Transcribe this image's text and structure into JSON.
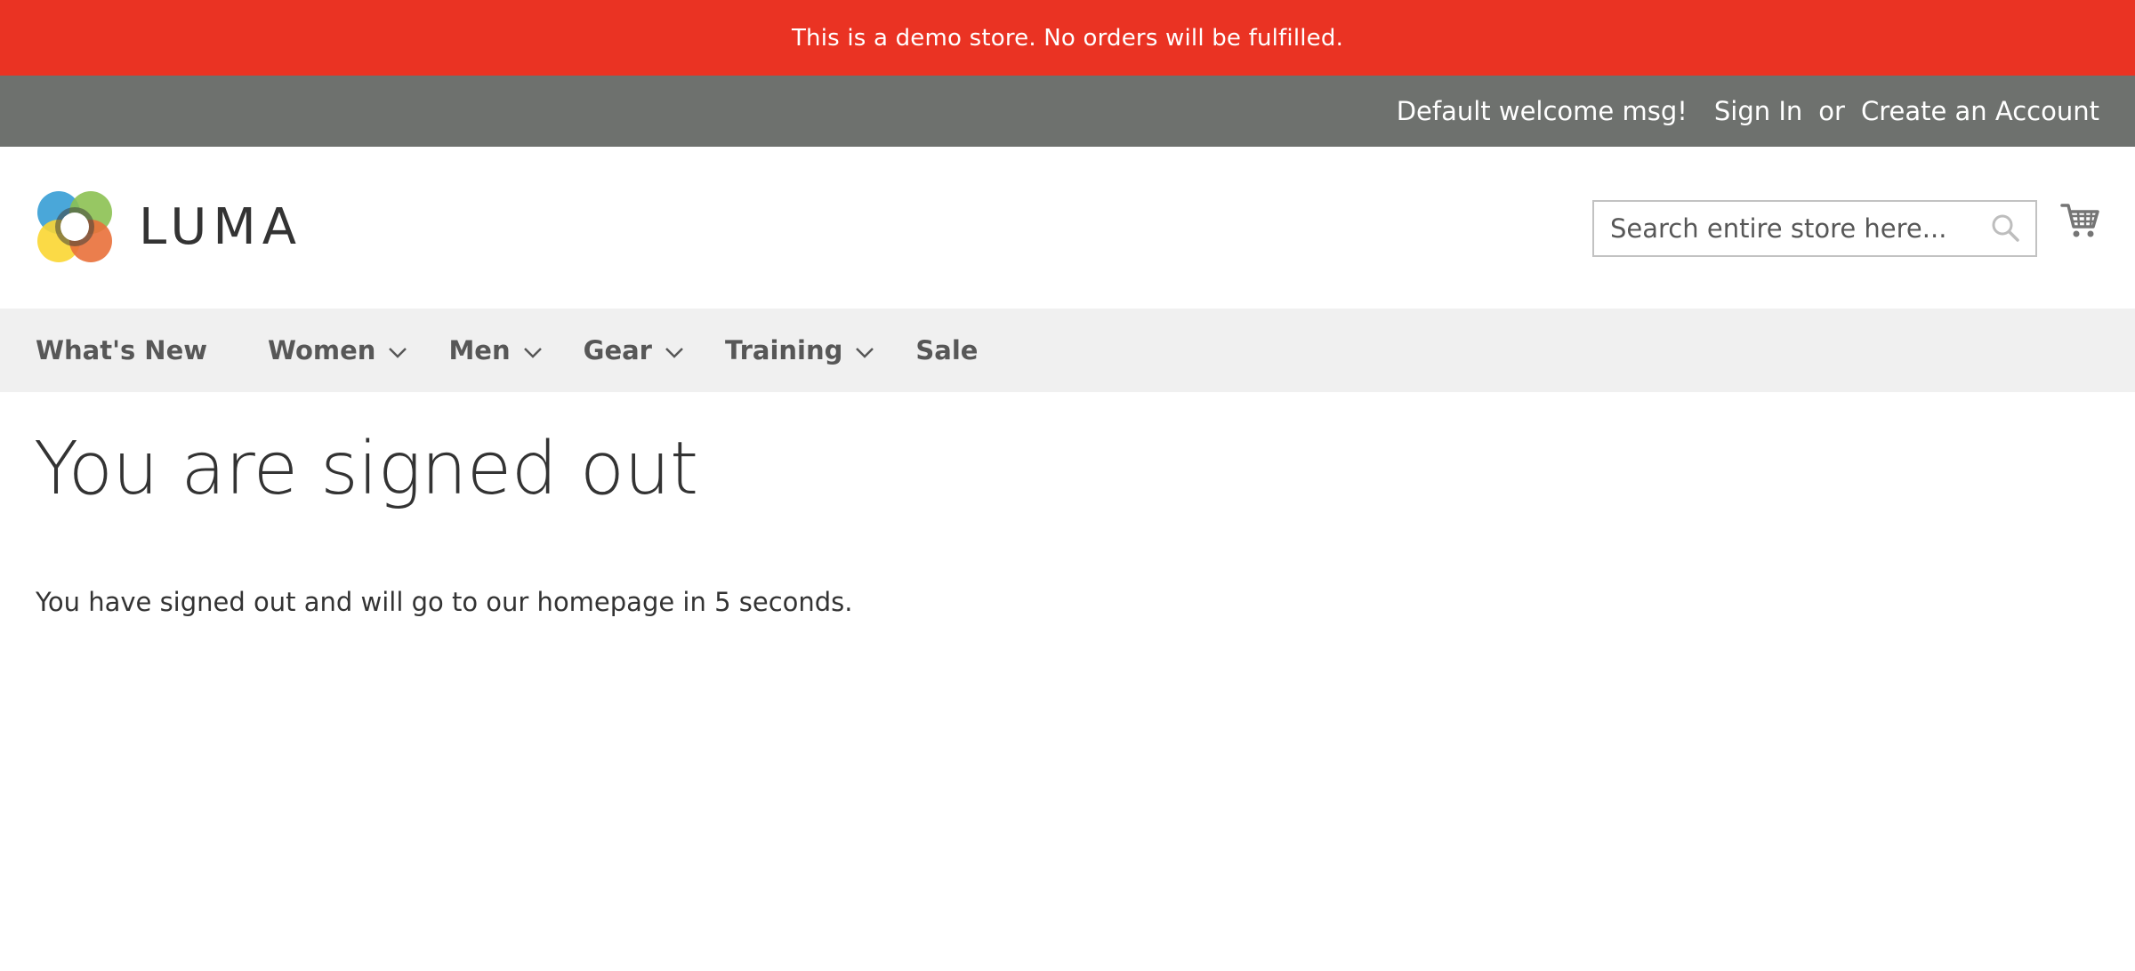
{
  "notice": {
    "text": "This is a demo store. No orders will be fulfilled."
  },
  "header_panel": {
    "welcome": "Default welcome msg!",
    "sign_in": "Sign In",
    "or": "or",
    "create_account": "Create an Account"
  },
  "logo": {
    "text": "LUMA",
    "icon": "luma-logo-icon"
  },
  "search": {
    "placeholder": "Search entire store here...",
    "value": "",
    "icon": "search-icon"
  },
  "cart": {
    "icon": "cart-icon"
  },
  "nav": {
    "items": [
      {
        "label": "What's New",
        "has_dropdown": false
      },
      {
        "label": "Women",
        "has_dropdown": true
      },
      {
        "label": "Men",
        "has_dropdown": true
      },
      {
        "label": "Gear",
        "has_dropdown": true
      },
      {
        "label": "Training",
        "has_dropdown": true
      },
      {
        "label": "Sale",
        "has_dropdown": false
      }
    ]
  },
  "main": {
    "title": "You are signed out",
    "message": "You have signed out and will go to our homepage in 5 seconds."
  },
  "colors": {
    "notice_bg": "#ea3323",
    "panel_bg": "#6e716e",
    "nav_bg": "#f0f0f0",
    "text": "#333333"
  }
}
